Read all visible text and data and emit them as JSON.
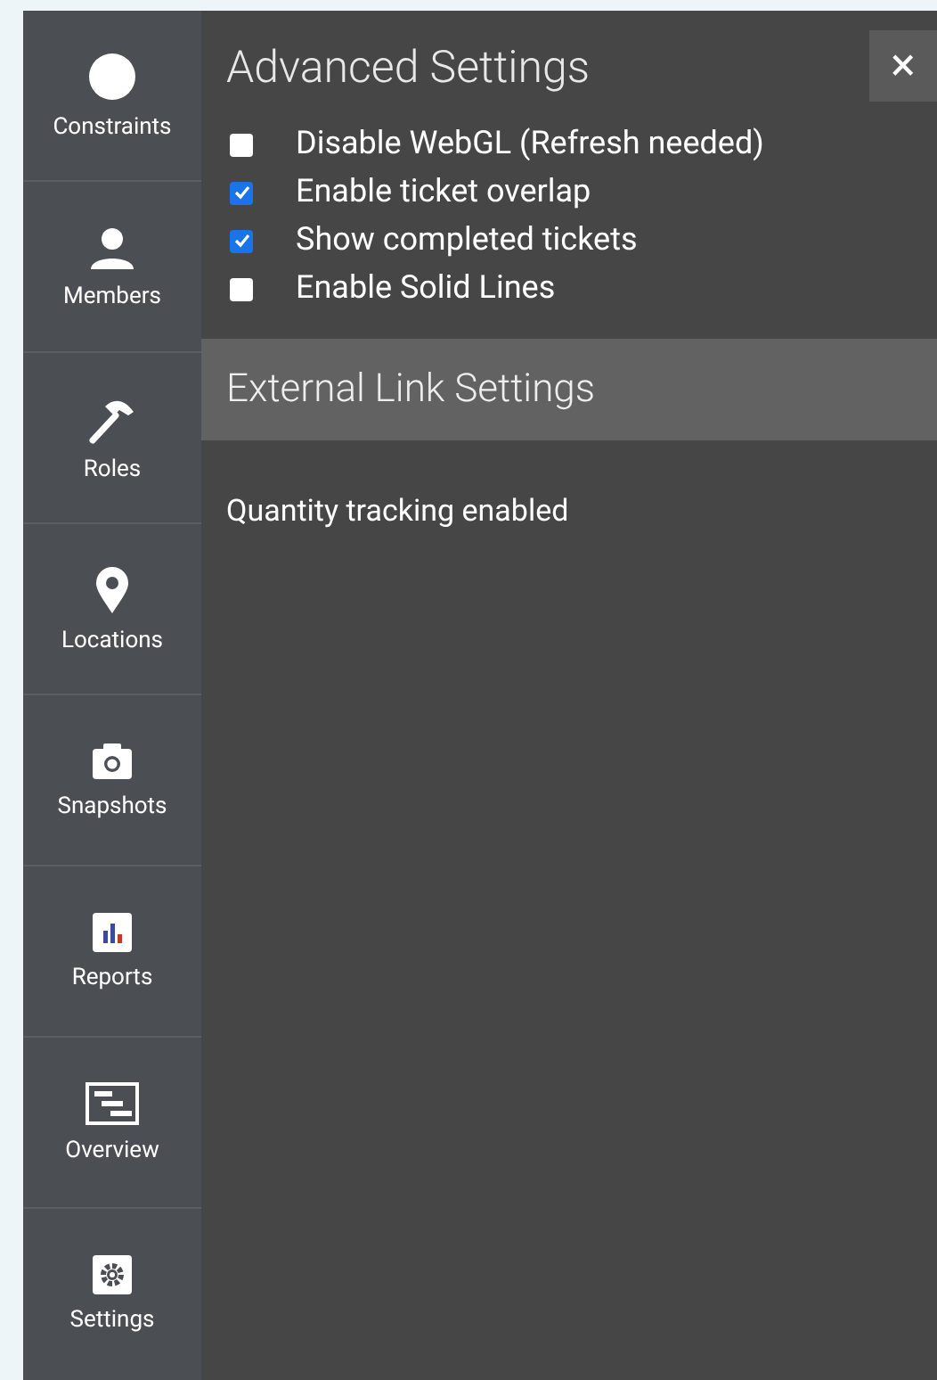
{
  "sidebar": {
    "items": [
      {
        "kind": "circle",
        "label": "Constraints"
      },
      {
        "kind": "person",
        "label": "Members"
      },
      {
        "kind": "hammer",
        "label": "Roles"
      },
      {
        "kind": "pin",
        "label": "Locations"
      },
      {
        "kind": "camera",
        "label": "Snapshots"
      },
      {
        "kind": "chart",
        "label": "Reports"
      },
      {
        "kind": "gantt",
        "label": "Overview"
      },
      {
        "kind": "gear",
        "label": "Settings"
      }
    ]
  },
  "panel": {
    "title": "Advanced Settings",
    "close": "×",
    "options": [
      {
        "label": "Disable WebGL (Refresh needed)",
        "checked": false
      },
      {
        "label": "Enable ticket overlap",
        "checked": true
      },
      {
        "label": "Show completed tickets",
        "checked": true
      },
      {
        "label": "Enable Solid Lines",
        "checked": false
      }
    ],
    "section": "External Link Settings",
    "note": "Quantity tracking enabled"
  }
}
